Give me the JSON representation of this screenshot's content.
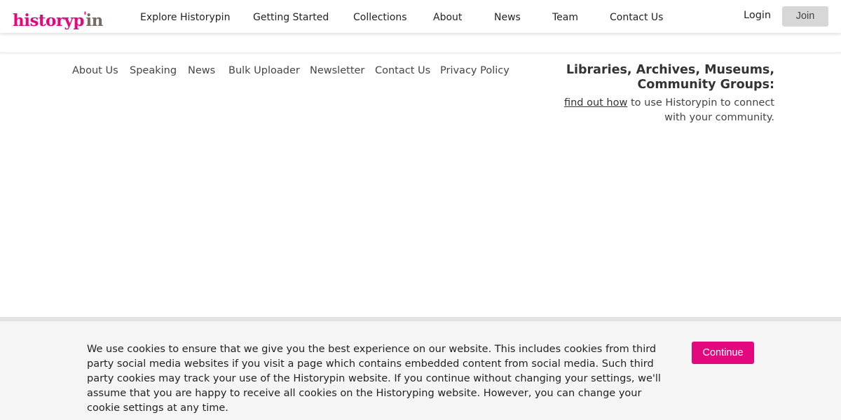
{
  "header": {
    "logo": {
      "main": "history",
      "mark": "p",
      "pin_glyph": "'",
      "tail": "in"
    },
    "nav": [
      "Explore Historypin",
      "Getting Started",
      "Collections",
      "About",
      "News",
      "Team",
      "Contact Us"
    ],
    "login_label": "Login",
    "join_label": "Join"
  },
  "footer": {
    "links": [
      "About Us",
      "Speaking",
      "News",
      "Bulk Uploader",
      "Newsletter",
      "Contact Us",
      "Privacy Policy"
    ],
    "cta": {
      "heading": "Libraries, Archives, Museums, Community Groups:",
      "link_text": "find out how",
      "text": " to use Historypin to connect with your community."
    }
  },
  "cookie_banner": {
    "message": "We use cookies to ensure that we give you the best experience on our website. This includes cookies from third party social media websites if you visit a page which contains embedded content from social media. Such third party cookies may track your use of the Historypin website. If you continue without changing your settings, we'll assume that you are happy to receive all cookies on the Historyping website. However, you can change your cookie settings at any time.",
    "button_label": "Continue"
  },
  "colors": {
    "brand": "#e4087f",
    "logo_tail": "#7a6a66",
    "join_bg": "#d7d7d7",
    "banner_bg": "#f5f5f5"
  }
}
